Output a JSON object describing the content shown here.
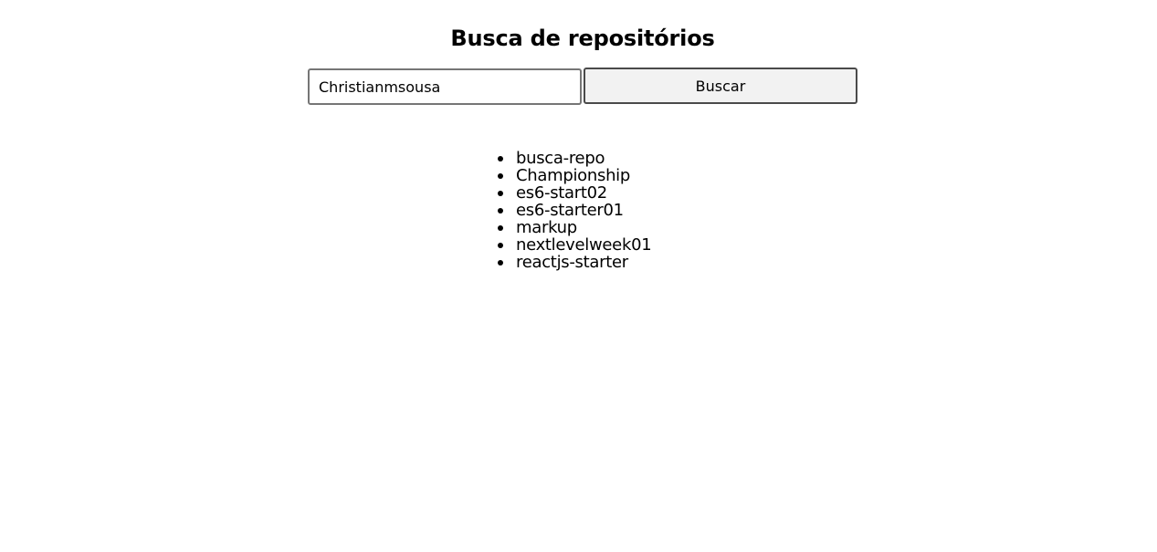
{
  "page": {
    "title": "Busca de repositórios"
  },
  "search": {
    "value": "Christianmsousa",
    "button_label": "Buscar"
  },
  "repositories": [
    "busca-repo",
    "Championship",
    "es6-start02",
    "es6-starter01",
    "markup",
    "nextlevelweek01",
    "reactjs-starter"
  ]
}
